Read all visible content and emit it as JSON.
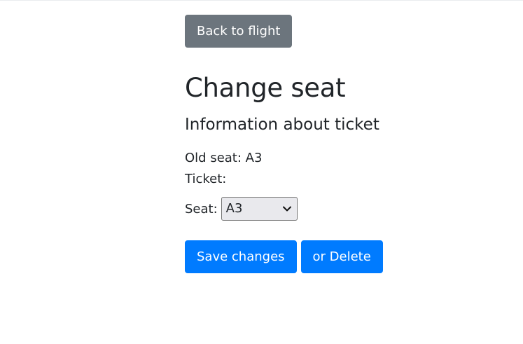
{
  "nav": {
    "back_label": "Back to flight"
  },
  "page": {
    "title": "Change seat",
    "section_title": "Information about ticket"
  },
  "info": {
    "old_seat_label": "Old seat:",
    "old_seat_value": "A3",
    "ticket_label": "Ticket:",
    "ticket_value": ""
  },
  "form": {
    "seat_label": "Seat:",
    "seat_selected": "A3"
  },
  "actions": {
    "save_label": "Save changes",
    "delete_label": "or Delete"
  },
  "icons": {
    "select_chevron": "chevron-down-icon"
  },
  "colors": {
    "secondary": "#6c757d",
    "primary": "#007bff",
    "text": "#212529"
  }
}
